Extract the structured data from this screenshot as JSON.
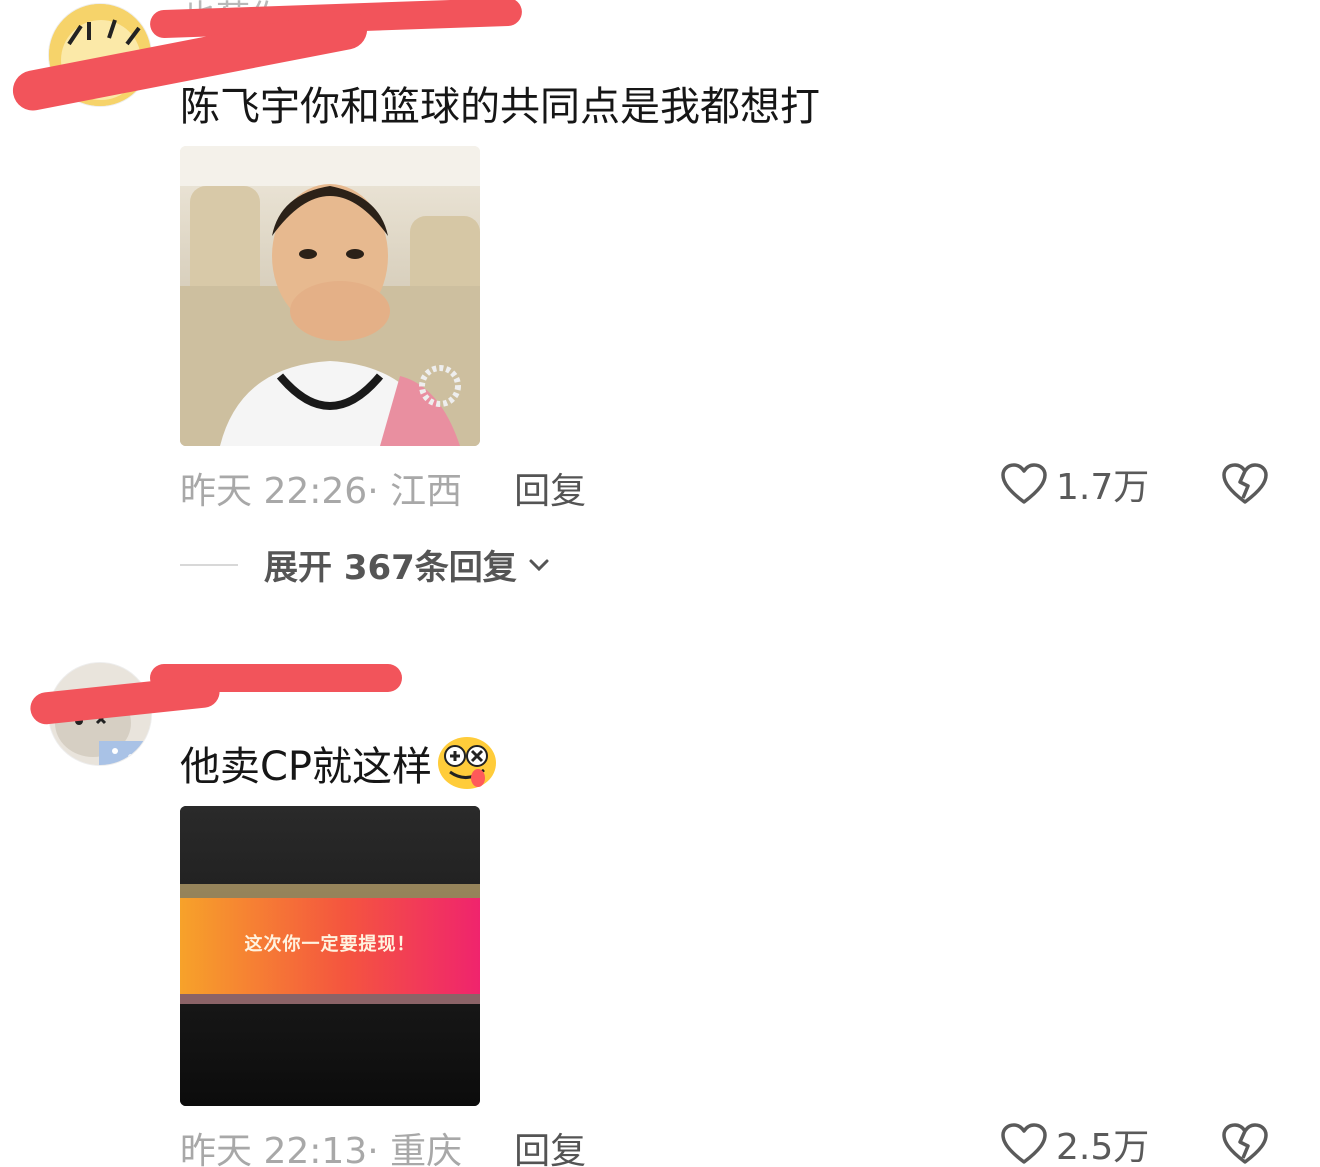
{
  "comments": [
    {
      "username_hint": "也莓你",
      "text": "陈飞宇你和篮球的共同点是我都想打",
      "time": "昨天 22:26",
      "location": "· 江西",
      "reply_label": "回复",
      "likes": "1.7万",
      "expand_label": "展开 367条回复"
    },
    {
      "text": "他卖CP就这样",
      "media_banner": "这次你一定要提现！",
      "time": "昨天 22:13",
      "location": "· 重庆",
      "reply_label": "回复",
      "likes": "2.5万"
    }
  ],
  "colors": {
    "redaction": "#f2545b",
    "text": "#161616",
    "meta": "#a8a8a8",
    "banner_start": "#f7a22a",
    "banner_end": "#f0246d"
  }
}
